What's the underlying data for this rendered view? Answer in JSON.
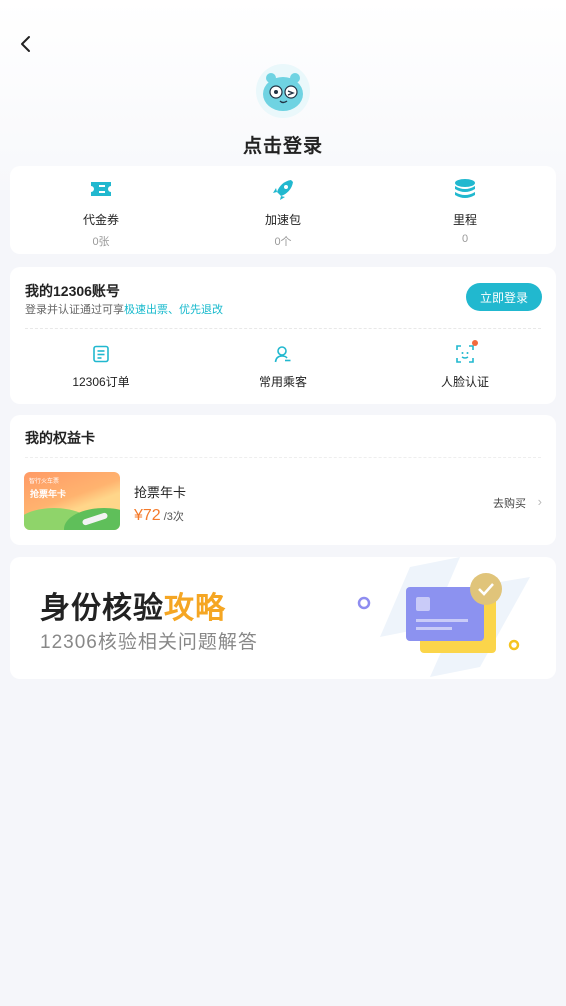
{
  "header": {
    "login_prompt": "点击登录"
  },
  "stats": [
    {
      "label": "代金券",
      "value": "0张",
      "icon": "ticket-icon"
    },
    {
      "label": "加速包",
      "value": "0个",
      "icon": "rocket-icon"
    },
    {
      "label": "里程",
      "value": "0",
      "icon": "coins-icon"
    }
  ],
  "account": {
    "title": "我的12306账号",
    "subtitle_prefix": "登录并认证通过可享",
    "subtitle_highlight": "极速出票、优先退改",
    "login_button": "立即登录",
    "links": [
      {
        "label": "12306订单",
        "icon": "order-icon"
      },
      {
        "label": "常用乘客",
        "icon": "passenger-icon"
      },
      {
        "label": "人脸认证",
        "icon": "face-scan-icon"
      }
    ]
  },
  "benefit": {
    "title": "我的权益卡",
    "card_brand": "智行火车票",
    "card_name": "抢票年卡",
    "name": "抢票年卡",
    "price": "¥72",
    "count": "/3次",
    "buy_label": "去购买",
    "chevron": "›"
  },
  "banner": {
    "title_main": "身份核验",
    "title_accent": "攻略",
    "subtitle": "12306核验相关问题解答"
  },
  "colors": {
    "accent": "#21b8cf",
    "price": "#f47a2a",
    "banner_accent": "#f5a623"
  }
}
